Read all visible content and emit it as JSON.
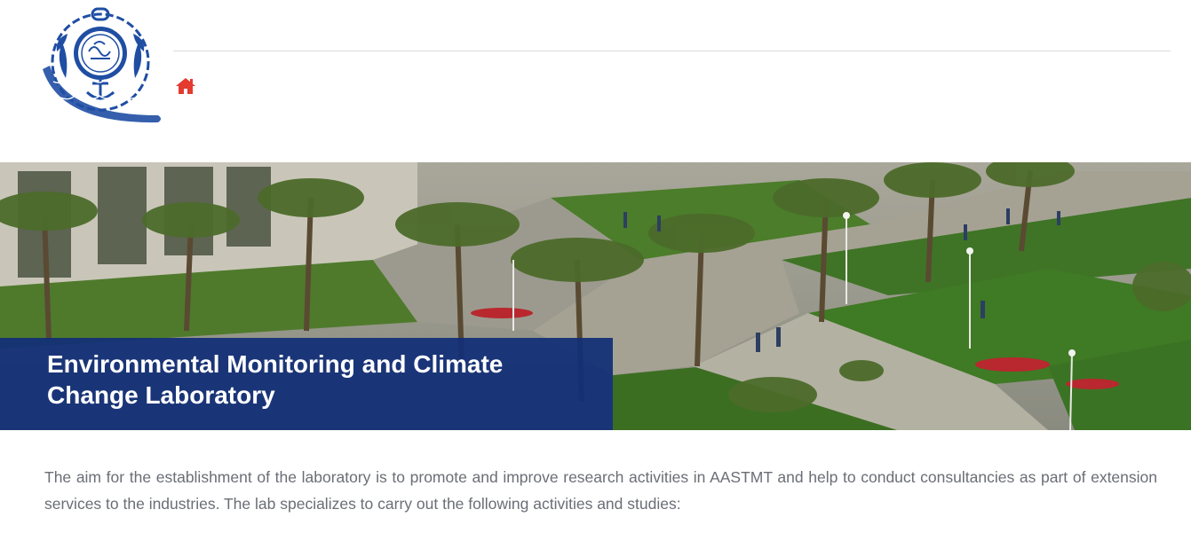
{
  "header": {
    "logo_name": "aastmt-seal-logo",
    "home_icon": "home-icon"
  },
  "hero": {
    "title": "Environmental Monitoring and Climate Change Laboratory"
  },
  "intro": {
    "text": "The aim for the establishment of the laboratory is to promote and improve research activities in AASTMT and help to conduct consultancies as part of extension services to the industries. The lab specializes to carry out the following activities and studies:"
  },
  "colors": {
    "caption_bg": "#112e76",
    "home_icon": "#e53a2f",
    "logo_blue": "#1f4ea3",
    "body_text": "#6a6e75"
  }
}
